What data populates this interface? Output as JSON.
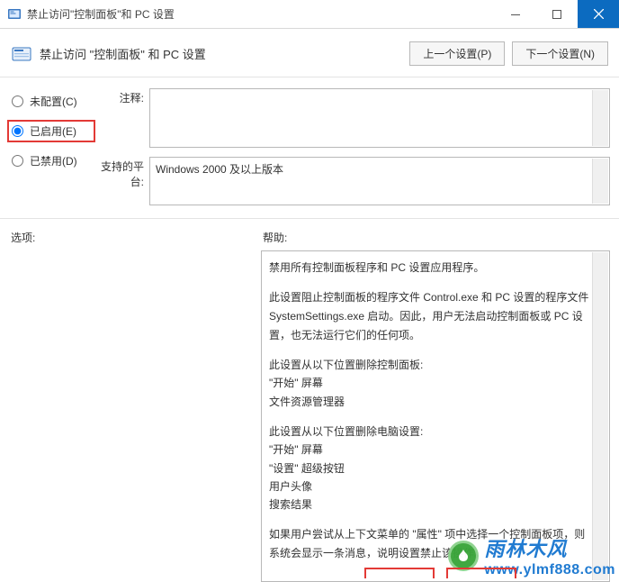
{
  "window": {
    "title": "禁止访问\"控制面板\"和 PC 设置"
  },
  "toolbar": {
    "heading": "禁止访问 \"控制面板\" 和 PC 设置",
    "prev_btn": "上一个设置(P)",
    "next_btn": "下一个设置(N)"
  },
  "radios": {
    "not_configured": "未配置(C)",
    "enabled": "已启用(E)",
    "disabled": "已禁用(D)"
  },
  "labels": {
    "comment": "注释:",
    "platform": "支持的平台:",
    "options": "选项:",
    "help": "帮助:"
  },
  "platform_text": "Windows 2000 及以上版本",
  "help": {
    "p1": "禁用所有控制面板程序和 PC 设置应用程序。",
    "p2": "此设置阻止控制面板的程序文件 Control.exe 和 PC 设置的程序文件 SystemSettings.exe 启动。因此，用户无法启动控制面板或 PC 设置，也无法运行它们的任何项。",
    "p3a": "此设置从以下位置删除控制面板:",
    "p3b": "\"开始\" 屏幕",
    "p3c": "文件资源管理器",
    "p4a": "此设置从以下位置删除电脑设置:",
    "p4b": "\"开始\" 屏幕",
    "p4c": "\"设置\" 超级按钮",
    "p4d": "用户头像",
    "p4e": "搜索结果",
    "p5": "如果用户尝试从上下文菜单的 \"属性\" 项中选择一个控制面板项，则系统会显示一条消息，说明设置禁止该操作。"
  },
  "watermark": {
    "main": "雨林木风",
    "url": "www.ylmf888.com"
  }
}
